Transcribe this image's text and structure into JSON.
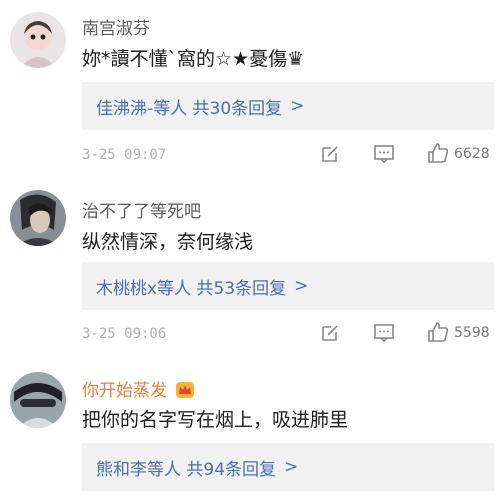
{
  "comments": [
    {
      "username": "南宫淑芬",
      "text": "妳*讀不懂`窩的☆★憂傷♛",
      "reply_summary": "佳沸沸-等人  共30条回复",
      "reply_arrow": ">",
      "time": "3-25 09:07",
      "likes": "6628"
    },
    {
      "username": "治不了了等死吧",
      "text": "纵然情深，奈何缘浅",
      "reply_summary": "木桃桃x等人  共53条回复",
      "reply_arrow": ">",
      "time": "3-25 09:06",
      "likes": "5598"
    },
    {
      "username": "你开始蒸发",
      "text": "把你的名字写在烟上，吸进肺里",
      "reply_summary": "熊和李等人  共94条回复",
      "reply_arrow": ">"
    }
  ],
  "colors": {
    "link": "#4a6fae",
    "vip_name": "#e8803b",
    "reply_bg": "#f1f1f1"
  },
  "icons": [
    "edit-icon",
    "comment-icon",
    "like-icon",
    "crown-badge-icon"
  ]
}
